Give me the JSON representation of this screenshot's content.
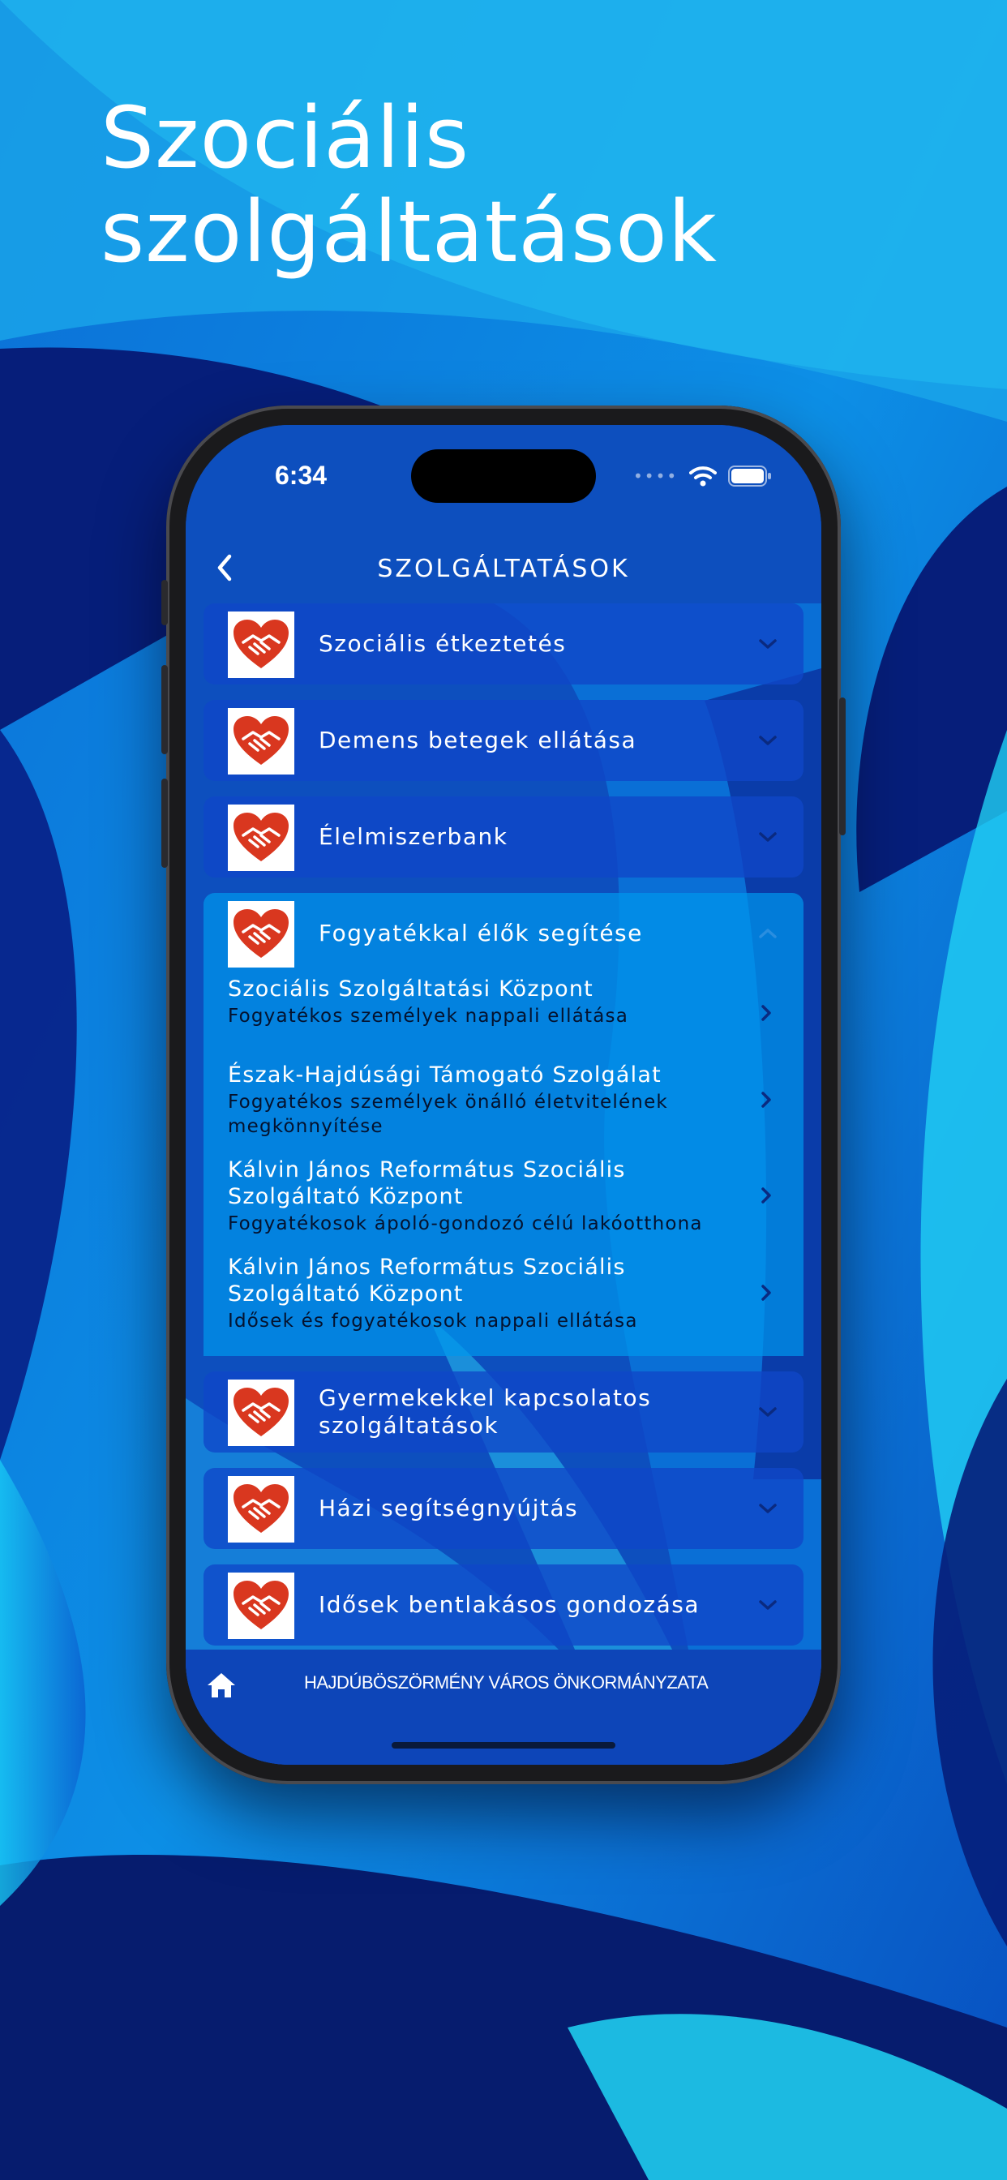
{
  "headline": {
    "line1": "Szociális",
    "line2": "szolgáltatások"
  },
  "status_bar": {
    "time": "6:34",
    "icons": [
      "signal-dots-icon",
      "wifi-icon",
      "battery-icon"
    ]
  },
  "nav": {
    "title": "SZOLGÁLTATÁSOK",
    "back_icon": "chevron-left-icon"
  },
  "categories": [
    {
      "label": "Szociális étkeztetés",
      "icon": "heart-handshake-icon",
      "expanded": false
    },
    {
      "label": "Demens betegek ellátása",
      "icon": "heart-handshake-icon",
      "expanded": false
    },
    {
      "label": "Élelmiszerbank",
      "icon": "heart-handshake-icon",
      "expanded": false
    },
    {
      "label": "Fogyatékkal élők segítése",
      "icon": "heart-handshake-icon",
      "expanded": true,
      "items": [
        {
          "title": "Szociális Szolgáltatási Központ",
          "desc": "Fogyatékos személyek nappali ellátása"
        },
        {
          "title": "Észak-Hajdúsági Támogató Szolgálat",
          "desc": "Fogyatékos személyek önálló életvitelének megkönnyítése"
        },
        {
          "title": "Kálvin János Református Szociális Szolgáltató Központ",
          "desc": "Fogyatékosok ápoló-gondozó célú lakóotthona"
        },
        {
          "title": "Kálvin János Református Szociális Szolgáltató Központ",
          "desc": "Idősek és fogyatékosok nappali ellátása"
        }
      ]
    },
    {
      "label": "Gyermekekkel kapcsolatos szolgáltatások",
      "icon": "heart-handshake-icon",
      "expanded": false
    },
    {
      "label": "Házi segítségnyújtás",
      "icon": "heart-handshake-icon",
      "expanded": false
    },
    {
      "label": "Idősek bentlakásos gondozása",
      "icon": "heart-handshake-icon",
      "expanded": false
    }
  ],
  "footer": {
    "home_icon": "home-icon",
    "text": "HAJDÚBÖSZÖRMÉNY VÁROS ÖNKORMÁNYZATA"
  },
  "colors": {
    "icon_red": "#d9371f",
    "bar_blue": "#1046c8",
    "expanded_blue": "#0096eb"
  }
}
